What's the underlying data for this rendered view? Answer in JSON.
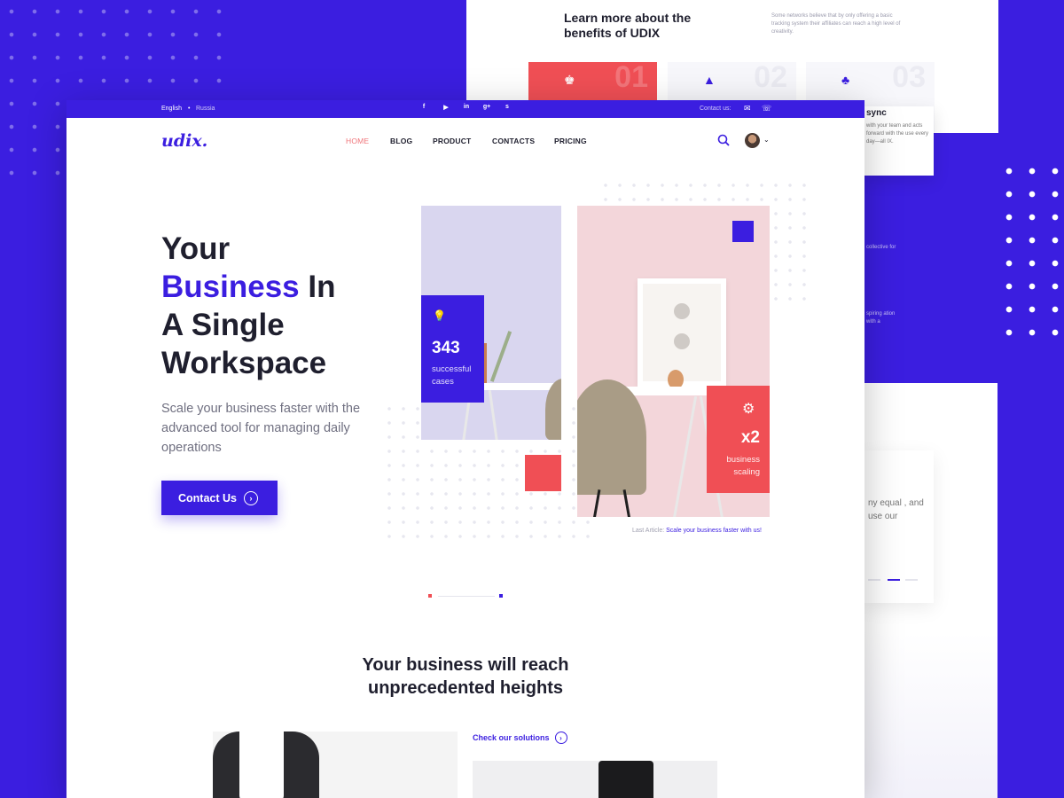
{
  "back_card": {
    "title": "Learn more about the benefits of UDIX",
    "text": "Some networks believe that by only offering a basic tracking system their affiliates can reach a high level of creativity.",
    "tiles": [
      {
        "num": "01",
        "icon": "chess-king-icon"
      },
      {
        "num": "02",
        "icon": "paper-plane-icon"
      },
      {
        "num": "03",
        "icon": "lamp-icon"
      }
    ]
  },
  "side_card": {
    "title": "sync",
    "text": "with your team and acts forward with the use every day—all IX."
  },
  "side_texts": [
    "collective for",
    "spiring ation with a"
  ],
  "quote_card": {
    "text": "ny equal , and use our"
  },
  "topbar": {
    "lang_en": "English",
    "lang_sep": "•",
    "lang_ru": "Russia",
    "socials": [
      "f",
      "▶",
      "in",
      "g+",
      "s"
    ],
    "contact_label": "Contact us:"
  },
  "nav": {
    "logo": "udix.",
    "items": [
      "HOME",
      "BLOG",
      "PRODUCT",
      "CONTACTS",
      "PRICING"
    ]
  },
  "hero": {
    "title_1": "Your",
    "title_hl": "Business",
    "title_2": " In",
    "title_3": "A Single",
    "title_4": "Workspace",
    "subtitle": "Scale your business faster with the advanced tool for managing daily operations",
    "cta": "Contact Us"
  },
  "stats": [
    {
      "icon": "lightbulb-icon",
      "value": "343",
      "label": "successful cases"
    },
    {
      "icon": "gear-icon",
      "value": "x2",
      "label": "business scaling"
    }
  ],
  "last_article": {
    "label": "Last Article:",
    "link": "Scale your business faster with us!"
  },
  "section": {
    "title": "Your business will reach unprecedented heights",
    "solutions": "Check our solutions"
  },
  "colors": {
    "accent": "#3b1ee0",
    "red": "#f04f55",
    "text": "#1f1f2e"
  }
}
